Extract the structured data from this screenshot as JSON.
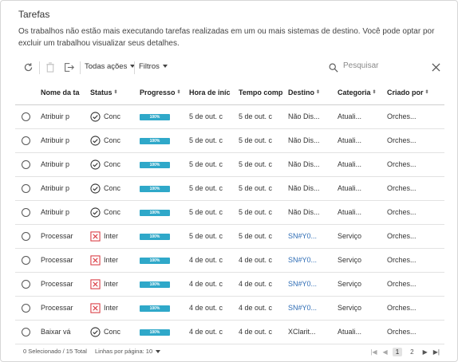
{
  "panel": {
    "title": "Tarefas",
    "description": "Os trabalhos não estão mais executando tarefas realizadas em um ou mais sistemas de destino. Você pode optar por excluir um trabalhou visualizar seus detalhes."
  },
  "toolbar": {
    "actions_label": "Todas ações",
    "filters_label": "Filtros",
    "search_placeholder": "Pesquisar"
  },
  "table": {
    "headers": [
      "Nome da ta",
      "Status",
      "Progresso",
      "Hora de iníc",
      "Tempo comp",
      "Destino",
      "Categoria",
      "Criado por"
    ],
    "rows": [
      {
        "name": "Atribuir p",
        "status": "Conc",
        "status_type": "ok",
        "progress": "100%",
        "start": "5 de out. c",
        "complete": "5 de out. c",
        "target": "Não Dis...",
        "target_link": false,
        "category": "Atuali...",
        "created_by": "Orches..."
      },
      {
        "name": "Atribuir p",
        "status": "Conc",
        "status_type": "ok",
        "progress": "100%",
        "start": "5 de out. c",
        "complete": "5 de out. c",
        "target": "Não Dis...",
        "target_link": false,
        "category": "Atuali...",
        "created_by": "Orches..."
      },
      {
        "name": "Atribuir p",
        "status": "Conc",
        "status_type": "ok",
        "progress": "100%",
        "start": "5 de out. c",
        "complete": "5 de out. c",
        "target": "Não Dis...",
        "target_link": false,
        "category": "Atuali...",
        "created_by": "Orches..."
      },
      {
        "name": "Atribuir p",
        "status": "Conc",
        "status_type": "ok",
        "progress": "100%",
        "start": "5 de out. c",
        "complete": "5 de out. c",
        "target": "Não Dis...",
        "target_link": false,
        "category": "Atuali...",
        "created_by": "Orches..."
      },
      {
        "name": "Atribuir p",
        "status": "Conc",
        "status_type": "ok",
        "progress": "100%",
        "start": "5 de out. c",
        "complete": "5 de out. c",
        "target": "Não Dis...",
        "target_link": false,
        "category": "Atuali...",
        "created_by": "Orches..."
      },
      {
        "name": "Processar",
        "status": "Inter",
        "status_type": "error",
        "progress": "100%",
        "start": "5 de out. c",
        "complete": "5 de out. c",
        "target": "SN#Y0...",
        "target_link": true,
        "category": "Serviço",
        "created_by": "Orches..."
      },
      {
        "name": "Processar",
        "status": "Inter",
        "status_type": "error",
        "progress": "100%",
        "start": "4 de out. c",
        "complete": "4 de out. c",
        "target": "SN#Y0...",
        "target_link": true,
        "category": "Serviço",
        "created_by": "Orches..."
      },
      {
        "name": "Processar",
        "status": "Inter",
        "status_type": "error",
        "progress": "100%",
        "start": "4 de out. c",
        "complete": "4 de out. c",
        "target": "SN#Y0...",
        "target_link": true,
        "category": "Serviço",
        "created_by": "Orches..."
      },
      {
        "name": "Processar",
        "status": "Inter",
        "status_type": "error",
        "progress": "100%",
        "start": "4 de out. c",
        "complete": "4 de out. c",
        "target": "SN#Y0...",
        "target_link": true,
        "category": "Serviço",
        "created_by": "Orches..."
      },
      {
        "name": "Baixar vá",
        "status": "Conc",
        "status_type": "ok",
        "progress": "100%",
        "start": "4 de out. c",
        "complete": "4 de out. c",
        "target": "XClarit...",
        "target_link": false,
        "category": "Atuali...",
        "created_by": "Orches..."
      }
    ]
  },
  "footer": {
    "selected_text": "0 Selecionado / 15 Total",
    "rows_per_page_text": "Linhas por página: 10",
    "pages": [
      "1",
      "2"
    ],
    "current_page": "1"
  },
  "colors": {
    "progress_bar": "#2fa8c9",
    "error_icon": "#d8323a",
    "link": "#2f6db5"
  },
  "icons": {
    "refresh": "refresh-icon",
    "delete": "trash-icon",
    "export": "export-icon",
    "search": "search-icon",
    "clear": "close-icon",
    "ok": "check-circle-icon",
    "error": "x-box-icon"
  }
}
